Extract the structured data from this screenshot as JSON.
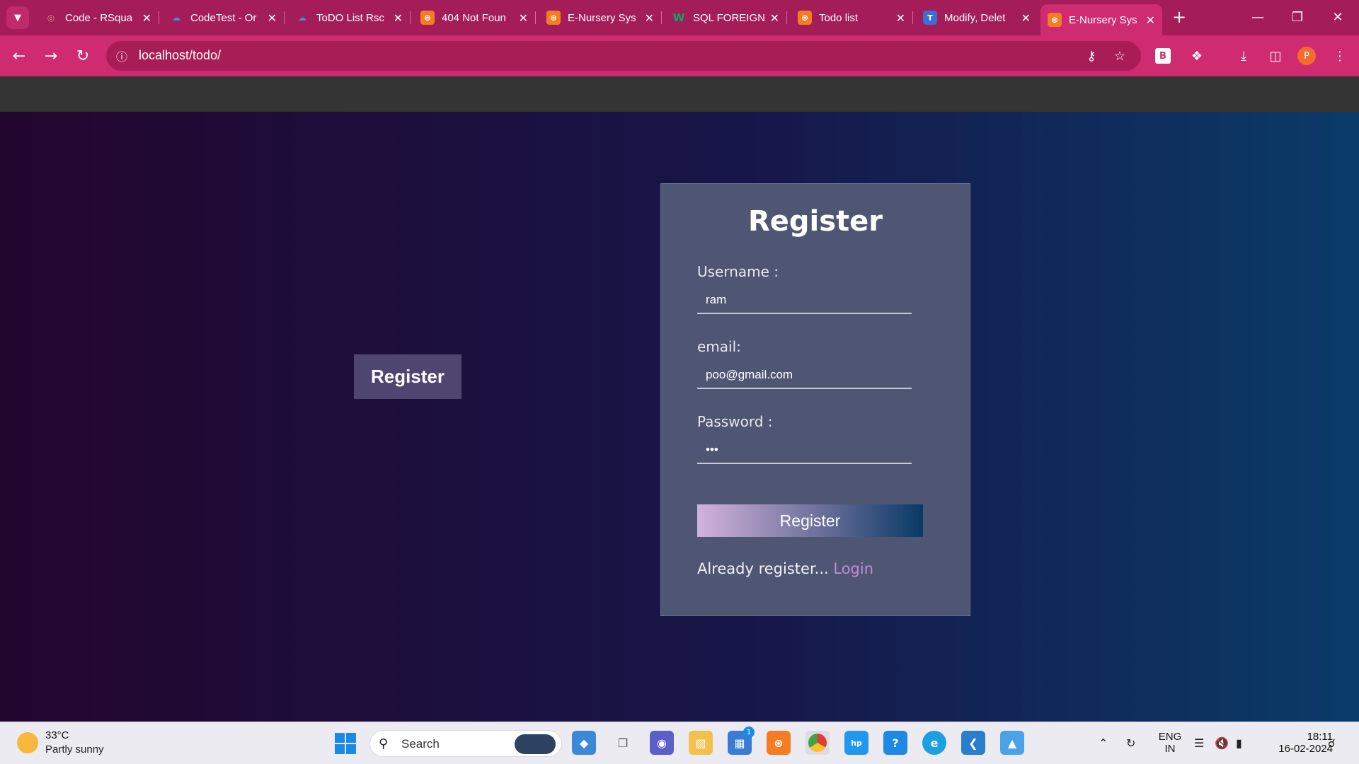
{
  "browser": {
    "tabs": [
      {
        "title": "Code - RSqua",
        "icon": "code-icon",
        "color": "#a51d58"
      },
      {
        "title": "CodeTest - Or",
        "icon": "onedrive-icon",
        "color": "#2b7fd6"
      },
      {
        "title": "ToDO List Rsc",
        "icon": "onedrive-icon",
        "color": "#2b7fd6"
      },
      {
        "title": "404 Not Foun",
        "icon": "xampp-icon",
        "color": "#f57c22"
      },
      {
        "title": "E-Nursery Sys",
        "icon": "xampp-icon",
        "color": "#f57c22"
      },
      {
        "title": "SQL FOREIGN",
        "icon": "w3schools-icon",
        "color": "#04aa6d"
      },
      {
        "title": "Todo list",
        "icon": "xampp-icon",
        "color": "#f57c22"
      },
      {
        "title": "Modify, Delet",
        "icon": "tutorialspoint-icon",
        "color": "#3b6fd6"
      },
      {
        "title": "E-Nursery Sys",
        "icon": "xampp-icon",
        "color": "#f57c22",
        "active": true
      }
    ],
    "url": "localhost/todo/",
    "profile_initial": "P",
    "extension_label": "B"
  },
  "page": {
    "side_button_label": "Register",
    "form": {
      "title": "Register",
      "username_label": "Username :",
      "username_value": "ram",
      "email_label": "email:",
      "email_value": "poo@gmail.com",
      "password_label": "Password :",
      "password_value": "•••",
      "submit_label": "Register",
      "already_text": "Already register...",
      "login_link": "Login"
    }
  },
  "taskbar": {
    "weather_temp": "33°C",
    "weather_desc": "Partly sunny",
    "search_placeholder": "Search",
    "lang_top": "ENG",
    "lang_bottom": "IN",
    "time": "18:11",
    "date": "16-02-2024",
    "store_badge": "1"
  }
}
